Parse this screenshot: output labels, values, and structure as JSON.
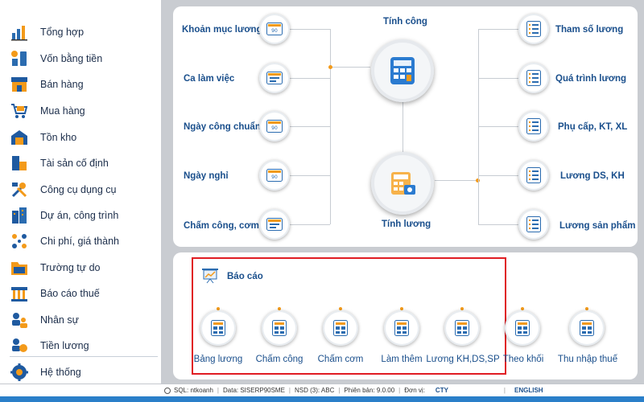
{
  "sidebar": {
    "items": [
      {
        "label": "Tổng hợp",
        "icon": "chart-icon"
      },
      {
        "label": "Vốn bằng tiền",
        "icon": "cash-icon"
      },
      {
        "label": "Bán hàng",
        "icon": "store-icon"
      },
      {
        "label": "Mua hàng",
        "icon": "cart-icon"
      },
      {
        "label": "Tồn kho",
        "icon": "warehouse-icon"
      },
      {
        "label": "Tài sản cố định",
        "icon": "asset-icon"
      },
      {
        "label": "Công cụ dụng cụ",
        "icon": "tools-icon"
      },
      {
        "label": "Dự án, công trình",
        "icon": "building-icon"
      },
      {
        "label": "Chi phí, giá thành",
        "icon": "cost-icon"
      },
      {
        "label": "Trường tự do",
        "icon": "folder-icon"
      },
      {
        "label": "Báo cáo thuế",
        "icon": "tax-icon"
      },
      {
        "label": "Nhân sự",
        "icon": "people-icon"
      },
      {
        "label": "Tiền lương",
        "icon": "salary-icon"
      },
      {
        "label": "Hệ thống",
        "icon": "gear-icon"
      }
    ]
  },
  "flow": {
    "left": [
      "Khoản mục lương",
      "Ca làm việc",
      "Ngày công chuẩn",
      "Ngày nghỉ",
      "Chấm công, cơm"
    ],
    "right": [
      "Tham số lương",
      "Quá trình lương",
      "Phụ cấp, KT, XL",
      "Lương DS, KH",
      "Lương sản phẩm"
    ],
    "center_top": "Tính công",
    "center_bottom": "Tính lương"
  },
  "reports": {
    "title": "Báo cáo",
    "items": [
      "Bảng lương",
      "Chấm công",
      "Chấm cơm",
      "Làm thêm",
      "Lương KH,DS,SP",
      "Theo khối",
      "Thu nhập thuế"
    ]
  },
  "status": {
    "sql": "SQL: ntkoanh",
    "data": "Data: SISERP90SME",
    "nsd": "NSD (3): ABC",
    "version": "Phiên bản: 9.0.00",
    "unit_label": "Đơn vị:",
    "unit": "CTY",
    "language": "ENGLISH"
  },
  "colors": {
    "accent": "#1a4f8c",
    "orange": "#f39a1a",
    "highlight_border": "#e01c23",
    "statusbar_strip": "#2a7fc9"
  }
}
